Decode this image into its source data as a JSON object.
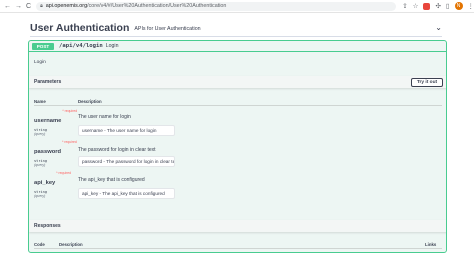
{
  "browser": {
    "url_host": "api.openemis.org",
    "url_path": "/core/v4/#/User%20Authentication/User%20Authentication",
    "nav_back": "←",
    "nav_forward": "→",
    "nav_reload": "C",
    "avatar_letter": "N"
  },
  "tag": {
    "title": "User Authentication",
    "description": "APIs for User Authentication"
  },
  "operation": {
    "method": "POST",
    "path": "/api/v4/login",
    "summary": "Login",
    "description": "Login"
  },
  "parameters": {
    "section_title": "Parameters",
    "try_it_out": "Try it out",
    "col_name": "Name",
    "col_description": "Description",
    "required_label": "* required",
    "items": [
      {
        "name": "username",
        "type": "string",
        "in": "(query)",
        "description": "The user name for login",
        "placeholder": "username - The user name for login"
      },
      {
        "name": "password",
        "type": "string",
        "in": "(query)",
        "description": "The password for login in clear text",
        "placeholder": "password - The password for login in clear te"
      },
      {
        "name": "api_key",
        "type": "string",
        "in": "(query)",
        "description": "The api_key that is configured",
        "placeholder": "api_key - The api_key that is configured"
      }
    ]
  },
  "responses": {
    "section_title": "Responses",
    "col_code": "Code",
    "col_description": "Description",
    "col_links": "Links"
  },
  "colors": {
    "post_green": "#49cc90",
    "op_bg": "#edf6f3",
    "required_red": "#ff6060"
  }
}
